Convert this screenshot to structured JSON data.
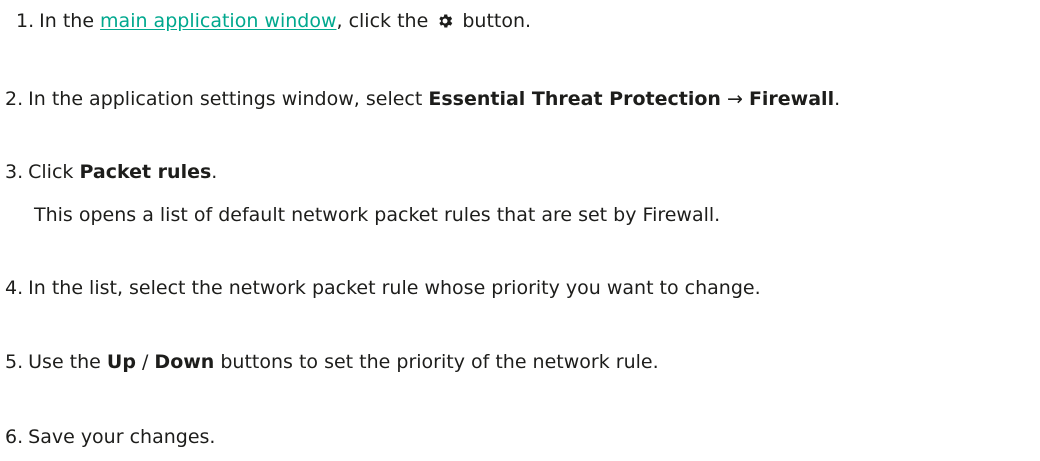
{
  "steps": [
    {
      "num": "1.",
      "before": "In the ",
      "link": "main application window",
      "middle": ", click the ",
      "icon": "gear-icon",
      "after": " button."
    },
    {
      "num": "2.",
      "before": "In the application settings window, select ",
      "bold1": "Essential Threat Protection",
      "arrow": " → ",
      "bold2": "Firewall",
      "after": "."
    },
    {
      "num": "3.",
      "before": "Click ",
      "bold1": "Packet rules",
      "after": ".",
      "note": "This opens a list of default network packet rules that are set by Firewall."
    },
    {
      "num": "4.",
      "text": "In the list, select the network packet rule whose priority you want to change."
    },
    {
      "num": "5.",
      "before": "Use the ",
      "bold1": "Up",
      "sep": " / ",
      "bold2": "Down",
      "after": " buttons to set the priority of the network rule."
    },
    {
      "num": "6.",
      "text": "Save your changes."
    }
  ],
  "colors": {
    "link": "#00a88e",
    "text": "#1d1d1b"
  }
}
